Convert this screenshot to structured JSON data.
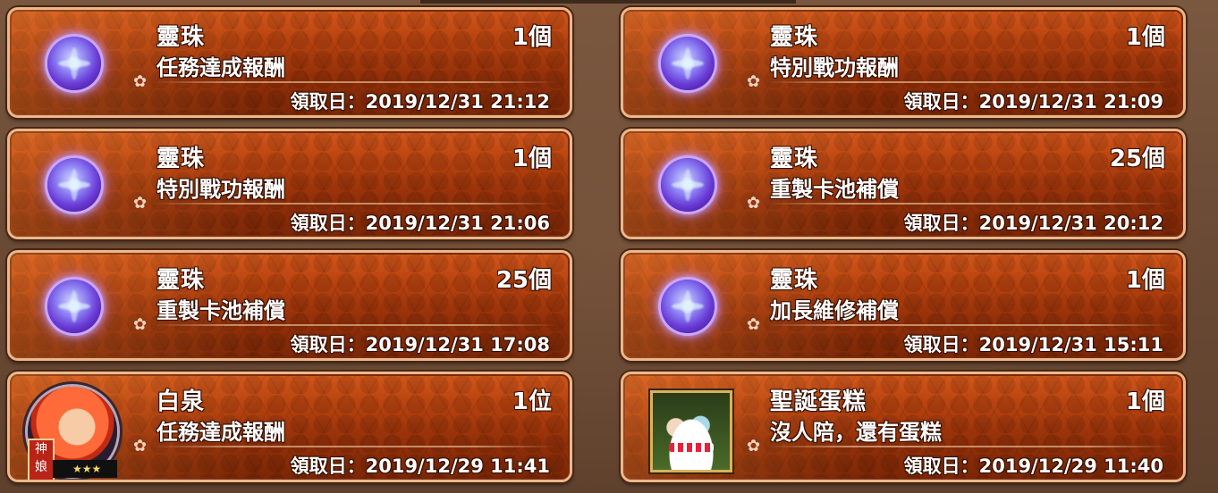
{
  "items": [
    {
      "name": "靈珠",
      "reason": "任務達成報酬",
      "count": "1個",
      "date": "領取日：2019/12/31  21:12",
      "icon": "spirit-orb-icon"
    },
    {
      "name": "靈珠",
      "reason": "特別戰功報酬",
      "count": "1個",
      "date": "領取日：2019/12/31  21:09",
      "icon": "spirit-orb-icon"
    },
    {
      "name": "靈珠",
      "reason": "特別戰功報酬",
      "count": "1個",
      "date": "領取日：2019/12/31  21:06",
      "icon": "spirit-orb-icon"
    },
    {
      "name": "靈珠",
      "reason": "重製卡池補償",
      "count": "25個",
      "date": "領取日：2019/12/31  20:12",
      "icon": "spirit-orb-icon"
    },
    {
      "name": "靈珠",
      "reason": "重製卡池補償",
      "count": "25個",
      "date": "領取日：2019/12/31  17:08",
      "icon": "spirit-orb-icon"
    },
    {
      "name": "靈珠",
      "reason": "加長維修補償",
      "count": "1個",
      "date": "領取日：2019/12/31  15:11",
      "icon": "spirit-orb-icon"
    },
    {
      "name": "白泉",
      "reason": "任務達成報酬",
      "count": "1位",
      "date": "領取日：2019/12/29  11:41",
      "icon": "character-portrait-icon",
      "stamp": "神娘",
      "stars": "★★★"
    },
    {
      "name": "聖誕蛋糕",
      "reason": "沒人陪，還有蛋糕",
      "count": "1個",
      "date": "領取日：2019/12/29  11:40",
      "icon": "christmas-cake-icon"
    }
  ],
  "colors": {
    "card_border": "#e9b98a",
    "card_fill": "#b8430f",
    "orb": "#8a7cf2"
  }
}
